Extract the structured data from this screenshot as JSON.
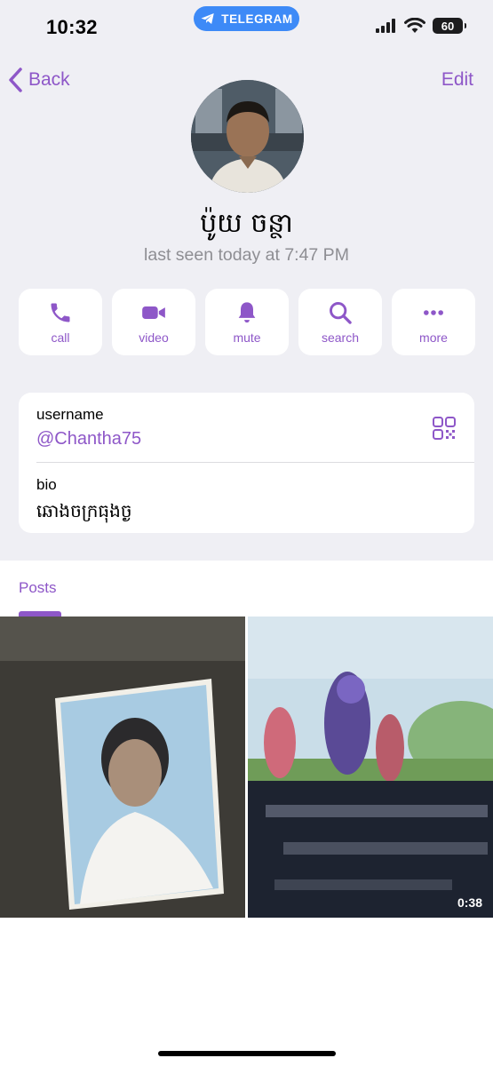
{
  "status_bar": {
    "time": "10:32",
    "app_pill": "TELEGRAM",
    "battery": "60",
    "icons": [
      "signal-icon",
      "wifi-icon",
      "battery-icon"
    ]
  },
  "nav": {
    "back_label": "Back",
    "edit_label": "Edit"
  },
  "profile": {
    "name": "ប៉ូយ ចន្ថា",
    "last_seen": "last seen today at 7:47 PM"
  },
  "actions": [
    {
      "label": "call",
      "icon": "phone-icon"
    },
    {
      "label": "video",
      "icon": "video-camera-icon"
    },
    {
      "label": "mute",
      "icon": "bell-icon"
    },
    {
      "label": "search",
      "icon": "search-icon"
    },
    {
      "label": "more",
      "icon": "more-dots-icon"
    }
  ],
  "info": {
    "username_label": "username",
    "username_value": "@Chantha75",
    "bio_label": "bio",
    "bio_value": "ឆោងចក្រធុងច្ង"
  },
  "posts": {
    "tab_label": "Posts",
    "items": [
      {
        "type": "photo"
      },
      {
        "type": "video",
        "duration": "0:38"
      }
    ]
  },
  "colors": {
    "accent": "#8e57c8",
    "background": "#efeff4",
    "pill": "#3d8af7",
    "secondary_text": "#8e8e93"
  }
}
